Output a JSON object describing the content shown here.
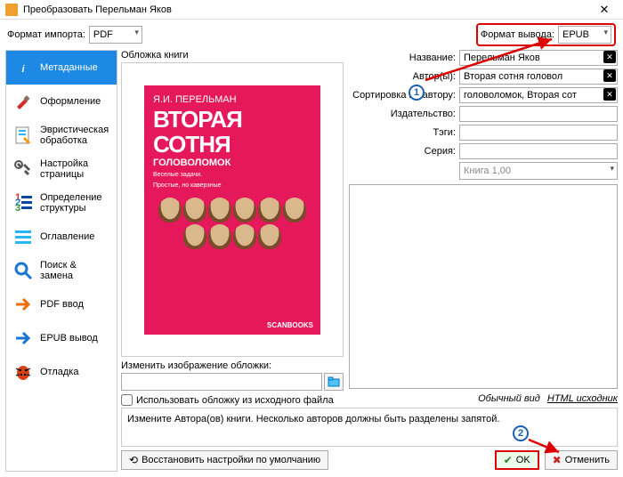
{
  "window": {
    "title": "Преобразовать Перельман Яков"
  },
  "import": {
    "label": "Формат импорта:",
    "value": "PDF"
  },
  "output": {
    "label": "Формат вывода:",
    "value": "EPUB"
  },
  "sidebar": {
    "items": [
      {
        "label": "Метаданные"
      },
      {
        "label": "Оформление"
      },
      {
        "label": "Эвристическая обработка"
      },
      {
        "label": "Настройка страницы"
      },
      {
        "label": "Определение структуры"
      },
      {
        "label": "Оглавление"
      },
      {
        "label": "Поиск & замена"
      },
      {
        "label": "PDF ввод"
      },
      {
        "label": "EPUB вывод"
      },
      {
        "label": "Отладка"
      }
    ]
  },
  "cover": {
    "section_label": "Обложка книги",
    "author": "Я.И. ПЕРЕЛЬМАН",
    "title1": "ВТОРАЯ",
    "title2": "СОТНЯ",
    "subtitle": "ГОЛОВОЛОМОК",
    "tag1": "Веселые задачи.",
    "tag2": "Простые, но каверзные",
    "publisher": "SCANBOOKS",
    "change_label": "Изменить изображение обложки:",
    "path_value": "",
    "use_source_label": "Использовать обложку из исходного файла"
  },
  "meta": {
    "title_label": "Название:",
    "title_value": "Перельман Яков",
    "authors_label": "Автор(ы):",
    "authors_value": "Вторая сотня головол",
    "sort_label": "Сортировка по автору:",
    "sort_value": "головоломок, Вторая сот",
    "publisher_label": "Издательство:",
    "publisher_value": "",
    "tags_label": "Тэги:",
    "tags_value": "",
    "series_label": "Серия:",
    "series_value": "",
    "series_index": "Книга 1,00"
  },
  "tabs": {
    "normal": "Обычный вид",
    "html": "HTML исходник"
  },
  "hint": "Измените Автора(ов) книги. Несколько авторов должны быть разделены запятой.",
  "buttons": {
    "restore": "Восстановить настройки по умолчанию",
    "ok": "OK",
    "cancel": "Отменить"
  }
}
